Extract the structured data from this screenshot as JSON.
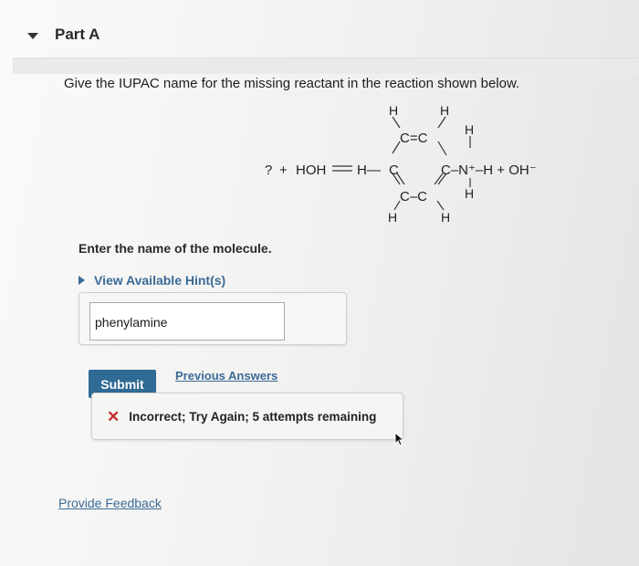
{
  "part": {
    "title": "Part A",
    "expanded": true
  },
  "question": {
    "text": "Give the IUPAC name for the missing reactant in the reaction shown below."
  },
  "reaction": {
    "unknown": "?",
    "plus": "+",
    "water": "HOH",
    "h_bond": "H—",
    "ring_c": "C",
    "ring_cc_top": "C=C",
    "ring_cc_bottom": "C–C",
    "h": "H",
    "nitrogen": "C–N⁺–H + OH⁻"
  },
  "prompt": {
    "text": "Enter the name of the molecule."
  },
  "hint": {
    "label": "View Available Hint(s)"
  },
  "answer": {
    "value": "phenylamine"
  },
  "actions": {
    "submit_label": "Submit",
    "previous_answers_label": "Previous Answers"
  },
  "feedback": {
    "icon": "x-icon",
    "text": "Incorrect; Try Again; 5 attempts remaining"
  },
  "footer": {
    "provide_feedback_label": "Provide Feedback"
  },
  "colors": {
    "accent": "#2f6b95",
    "link": "#3b6a96",
    "error": "#c62c2c"
  }
}
